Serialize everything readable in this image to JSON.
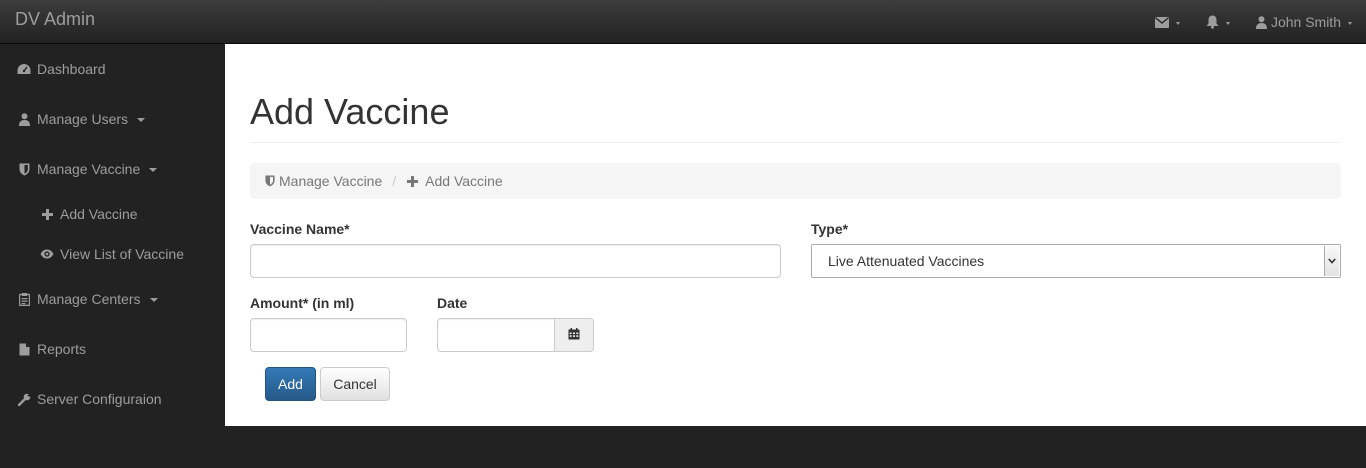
{
  "navbar": {
    "brand": "DV Admin",
    "user_name": "John Smith",
    "icons": [
      "envelope-icon",
      "bell-icon",
      "user-icon"
    ]
  },
  "sidebar": {
    "items": [
      {
        "label": "Dashboard",
        "icon": "dashboard-icon"
      },
      {
        "label": "Manage Users",
        "icon": "user-icon"
      },
      {
        "label": "Manage Vaccine",
        "icon": "shield-icon"
      },
      {
        "label": "Manage Centers",
        "icon": "clipboard-icon"
      },
      {
        "label": "Reports",
        "icon": "file-icon"
      },
      {
        "label": "Server Configuraion",
        "icon": "wrench-icon"
      }
    ],
    "subitems": [
      {
        "label": "Add Vaccine",
        "icon": "plus-icon"
      },
      {
        "label": "View List of Vaccine",
        "icon": "eye-icon"
      }
    ]
  },
  "main": {
    "title": "Add Vaccine",
    "breadcrumb": [
      {
        "label": "Manage Vaccine",
        "icon": "shield-icon"
      },
      {
        "label": "Add Vaccine",
        "icon": "plus-icon"
      }
    ],
    "form": {
      "vaccine_name_label": "Vaccine Name*",
      "vaccine_name_value": "",
      "type_label": "Type*",
      "type_selected": "Live Attenuated Vaccines",
      "amount_label": "Amount* (in ml)",
      "amount_value": "",
      "date_label": "Date",
      "date_value": "",
      "add_button": "Add",
      "cancel_button": "Cancel"
    }
  },
  "colors": {
    "navbar_bg": "#222222",
    "nav_text": "#9d9d9d",
    "primary": "#337ab7",
    "breadcrumb_bg": "#f5f5f5"
  }
}
